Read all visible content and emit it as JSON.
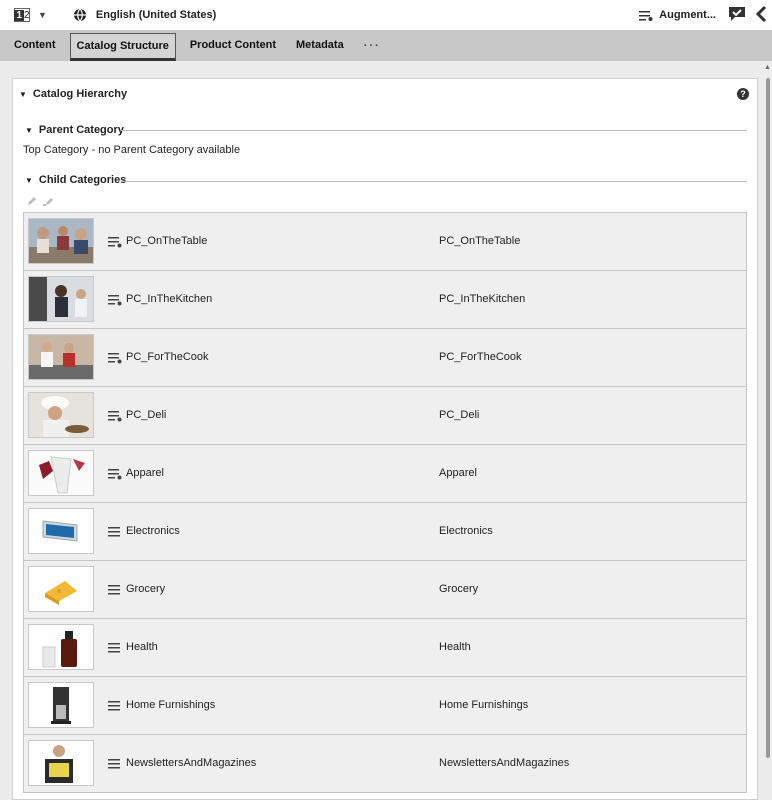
{
  "topbar": {
    "badge": "2",
    "badge_prefix": "1",
    "language": "English (United States)",
    "augment_label": "Augment..."
  },
  "tabs": [
    {
      "label": "Content"
    },
    {
      "label": "Catalog Structure"
    },
    {
      "label": "Product Content"
    },
    {
      "label": "Metadata"
    }
  ],
  "more_tabs": "···",
  "hierarchy": {
    "title": "Catalog Hierarchy",
    "help": "?",
    "parent": {
      "title": "Parent Category",
      "text": "Top Category - no Parent Category available"
    },
    "children": {
      "title": "Child Categories",
      "rows": [
        {
          "name": "PC_OnTheTable",
          "id": "PC_OnTheTable",
          "icon": "list-star-icon"
        },
        {
          "name": "PC_InTheKitchen",
          "id": "PC_InTheKitchen",
          "icon": "list-star-icon"
        },
        {
          "name": "PC_ForTheCook",
          "id": "PC_ForTheCook",
          "icon": "list-star-icon"
        },
        {
          "name": "PC_Deli",
          "id": "PC_Deli",
          "icon": "list-star-icon"
        },
        {
          "name": "Apparel",
          "id": "Apparel",
          "icon": "list-star-icon"
        },
        {
          "name": "Electronics",
          "id": "Electronics",
          "icon": "list-icon"
        },
        {
          "name": "Grocery",
          "id": "Grocery",
          "icon": "list-icon"
        },
        {
          "name": "Health",
          "id": "Health",
          "icon": "list-icon"
        },
        {
          "name": "Home Furnishings",
          "id": "Home Furnishings",
          "icon": "list-icon"
        },
        {
          "name": "NewslettersAndMagazines",
          "id": "NewslettersAndMagazines",
          "icon": "list-icon"
        }
      ]
    }
  }
}
